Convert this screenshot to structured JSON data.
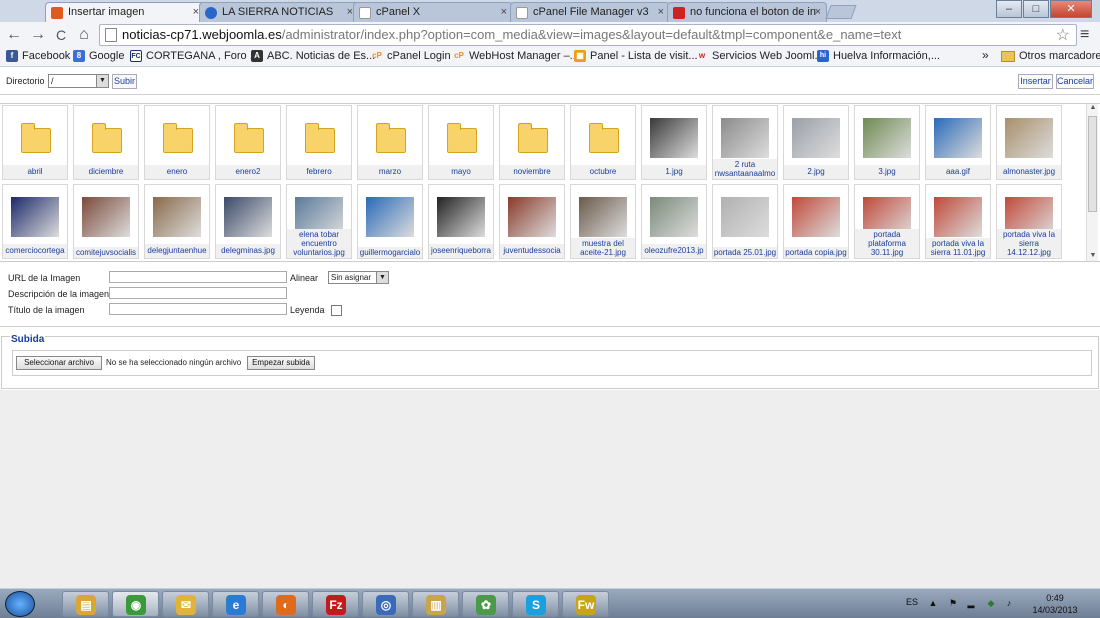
{
  "browser": {
    "tabs": [
      {
        "label": "Insertar imagen",
        "active": true,
        "fav_color": "#e05a1d"
      },
      {
        "label": "LA SIERRA NOTICIAS",
        "active": false,
        "fav_color": "#2a65c8"
      },
      {
        "label": "cPanel X",
        "active": false,
        "fav_color": "#ffffff"
      },
      {
        "label": "cPanel File Manager v3",
        "active": false,
        "fav_color": "#ffffff"
      },
      {
        "label": "no funciona el boton de in",
        "active": false,
        "fav_color": "#cc2222"
      }
    ],
    "tab_close": "×",
    "window_buttons": {
      "minimize": "–",
      "maximize": "□",
      "close": "✕"
    },
    "nav": {
      "back": "←",
      "forward": "→",
      "reload": "C",
      "home": "⌂"
    },
    "url_host": "noticias-cp71.webjoomla.es",
    "url_path": "/administrator/index.php?option=com_media&view=images&layout=default&tmpl=component&e_name=text",
    "star": "☆",
    "menu": "≡",
    "bookmarks": [
      {
        "label": "Facebook",
        "icon": "facebook-icon",
        "color": "#3b5998",
        "glyph": "f"
      },
      {
        "label": "Google",
        "icon": "google-icon",
        "color": "#3a6fd8",
        "glyph": "8"
      },
      {
        "label": "CORTEGANA , Foro ...",
        "icon": "fc-icon",
        "color": "#1a2f7a",
        "glyph": "FC"
      },
      {
        "label": "ABC. Noticias de Es...",
        "icon": "abc-icon",
        "color": "#333333",
        "glyph": "A"
      },
      {
        "label": "cPanel Login",
        "icon": "cpanel-icon",
        "color": "#f28b1c",
        "glyph": "cP"
      },
      {
        "label": "WebHost Manager –...",
        "icon": "cpanel-icon",
        "color": "#f28b1c",
        "glyph": "cP"
      },
      {
        "label": "Panel - Lista de visit...",
        "icon": "panel-icon",
        "color": "#f29a1c",
        "glyph": "▦"
      },
      {
        "label": "Servicios Web Jooml...",
        "icon": "w-icon",
        "color": "#cc2222",
        "glyph": "w"
      },
      {
        "label": "Huelva Información,...",
        "icon": "hi-icon",
        "color": "#2a65c8",
        "glyph": "hi"
      }
    ],
    "more": "»",
    "other_bookmarks": "Otros marcadores"
  },
  "page": {
    "directorio_label": "Directorio",
    "directorio_value": "/",
    "subir": "Subir",
    "insertar": "Insertar",
    "cancelar": "Cancelar",
    "items": [
      {
        "name": "abril",
        "type": "folder"
      },
      {
        "name": "diciembre",
        "type": "folder"
      },
      {
        "name": "enero",
        "type": "folder"
      },
      {
        "name": "enero2",
        "type": "folder"
      },
      {
        "name": "febrero",
        "type": "folder"
      },
      {
        "name": "marzo",
        "type": "folder"
      },
      {
        "name": "mayo",
        "type": "folder"
      },
      {
        "name": "noviembre",
        "type": "folder"
      },
      {
        "name": "octubre",
        "type": "folder"
      },
      {
        "name": "1.jpg",
        "type": "image",
        "color": "#3a3a3a"
      },
      {
        "name": "2 ruta nwsantaanaalmo",
        "type": "image",
        "color": "#8b8b8b"
      },
      {
        "name": "2.jpg",
        "type": "image",
        "color": "#9aa0a8"
      },
      {
        "name": "3.jpg",
        "type": "image",
        "color": "#6f8a52"
      },
      {
        "name": "aaa.gif",
        "type": "image",
        "color": "#2a6ab8"
      },
      {
        "name": "almonaster.jpg",
        "type": "image",
        "color": "#a88f6a"
      },
      {
        "name": "comerciocortega",
        "type": "image",
        "color": "#1c2a6b"
      },
      {
        "name": "comitejuvsocialis",
        "type": "image",
        "color": "#7b4a3a"
      },
      {
        "name": "delegjuntaenhue",
        "type": "image",
        "color": "#8a6a4a"
      },
      {
        "name": "delegminas.jpg",
        "type": "image",
        "color": "#3b4a6a"
      },
      {
        "name": "elena tobar encuentro voluntarios.jpg",
        "type": "image",
        "color": "#5a7a9a"
      },
      {
        "name": "guillermogarcialo",
        "type": "image",
        "color": "#2a6ab8"
      },
      {
        "name": "joseenriqueborra",
        "type": "image",
        "color": "#222222"
      },
      {
        "name": "juventudessocia",
        "type": "image",
        "color": "#8a3a2a"
      },
      {
        "name": "muestra del aceite-21.jpg",
        "type": "image",
        "color": "#6a5a4a"
      },
      {
        "name": "oleozufre2013.jp",
        "type": "image",
        "color": "#7a8a7a"
      },
      {
        "name": "portada 25.01.jpg",
        "type": "image",
        "color": "#b0b0b0"
      },
      {
        "name": "portada copia.jpg",
        "type": "image",
        "color": "#c04a3a"
      },
      {
        "name": "portada plataforma 30.11.jpg",
        "type": "image",
        "color": "#c04a3a"
      },
      {
        "name": "portada viva la sierra 11.01.jpg",
        "type": "image",
        "color": "#c04a3a"
      },
      {
        "name": "portada viva la sierra 14.12.12.jpg",
        "type": "image",
        "color": "#c04a3a"
      }
    ],
    "fields": {
      "url_label": "URL de la Imagen",
      "alinear_label": "Alinear",
      "alinear_value": "Sin asignar",
      "descripcion_label": "Descripción de la imagen",
      "titulo_label": "Título de la imagen",
      "leyenda_label": "Leyenda"
    },
    "subida": {
      "legend": "Subida",
      "choose_file": "Seleccionar archivo",
      "no_file": "No se ha seleccionado ningún archivo",
      "start": "Empezar subida"
    }
  },
  "taskbar": {
    "apps": [
      {
        "name": "explorer-icon",
        "color": "#d9a63a",
        "glyph": "▤"
      },
      {
        "name": "chrome-icon",
        "color": "#3a9a3a",
        "glyph": "◉",
        "active": true
      },
      {
        "name": "outlook-icon",
        "color": "#e0b43a",
        "glyph": "✉"
      },
      {
        "name": "ie-icon",
        "color": "#2a7ad8",
        "glyph": "e"
      },
      {
        "name": "firefox-icon",
        "color": "#e06a1a",
        "glyph": "◐"
      },
      {
        "name": "filezilla-icon",
        "color": "#c41a1a",
        "glyph": "Fz"
      },
      {
        "name": "network-icon",
        "color": "#3a6ab8",
        "glyph": "◎"
      },
      {
        "name": "folder-icon",
        "color": "#c8a44a",
        "glyph": "▥"
      },
      {
        "name": "people-icon",
        "color": "#4a9a4a",
        "glyph": "✿"
      },
      {
        "name": "skype-icon",
        "color": "#1aa0e0",
        "glyph": "S"
      },
      {
        "name": "fireworks-icon",
        "color": "#c8a41a",
        "glyph": "Fw"
      }
    ],
    "lang": "ES",
    "time": "0:49",
    "date": "14/03/2013"
  }
}
